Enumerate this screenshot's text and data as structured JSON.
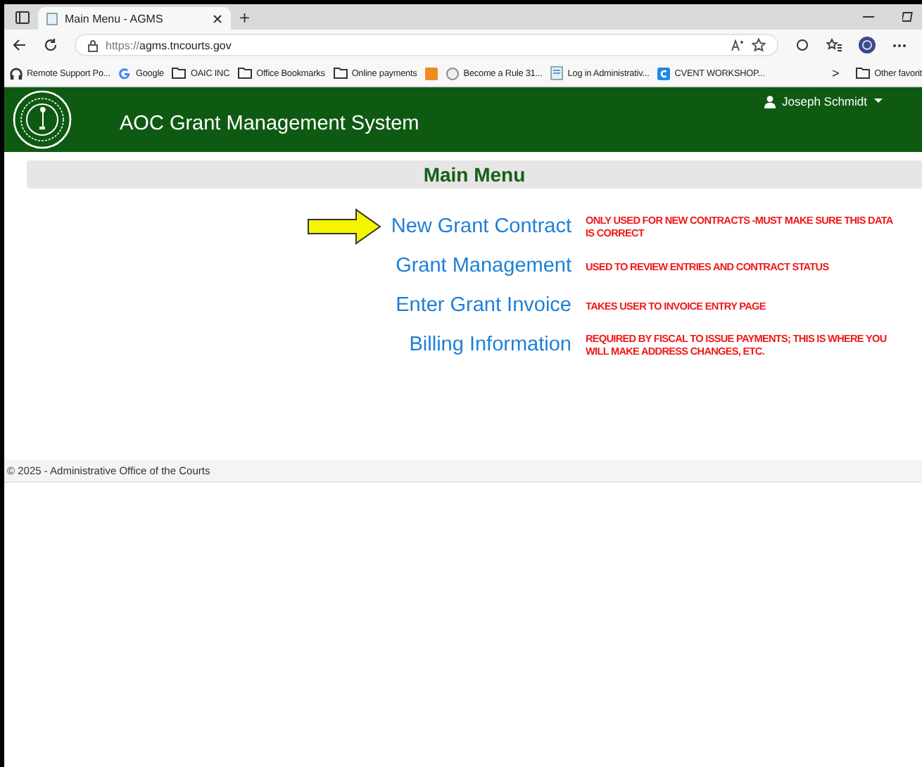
{
  "browser": {
    "tab_title": "Main Menu - AGMS",
    "new_tab": "+",
    "url_scheme": "https://",
    "url_host": "agms.tncourts.gov",
    "bookmarks": [
      {
        "label": "Remote Support Po...",
        "kind": "headset"
      },
      {
        "label": "Google",
        "kind": "google"
      },
      {
        "label": "OAIC INC",
        "kind": "folder"
      },
      {
        "label": "Office Bookmarks",
        "kind": "folder"
      },
      {
        "label": "Online payments",
        "kind": "folder"
      },
      {
        "kind": "orange"
      },
      {
        "label": "Become a Rule 31...",
        "kind": "circle"
      },
      {
        "label": "Log in Administrativ...",
        "kind": "page"
      },
      {
        "label": "CVENT WORKSHOP...",
        "kind": "cvent"
      }
    ],
    "more": ">",
    "other": "Other favorit"
  },
  "header": {
    "title": "AOC Grant Management System",
    "user": "Joseph Schmidt"
  },
  "heading": "Main Menu",
  "menu": [
    {
      "label": "New Grant Contract",
      "note": "ONLY USED FOR NEW CONTRACTS -MUST MAKE SURE THIS DATA IS CORRECT",
      "pointed": true
    },
    {
      "label": "Grant Management",
      "note": "USED TO REVIEW ENTRIES AND CONTRACT STATUS",
      "pointed": false
    },
    {
      "label": "Enter Grant Invoice",
      "note": "TAKES USER TO INVOICE ENTRY PAGE",
      "pointed": false
    },
    {
      "label": "Billing Information",
      "note": "REQUIRED BY FISCAL TO ISSUE PAYMENTS; THIS IS WHERE YOU WILL MAKE ADDRESS CHANGES, ETC.",
      "pointed": false
    }
  ],
  "footer": "© 2025 - Administrative Office of the Courts"
}
